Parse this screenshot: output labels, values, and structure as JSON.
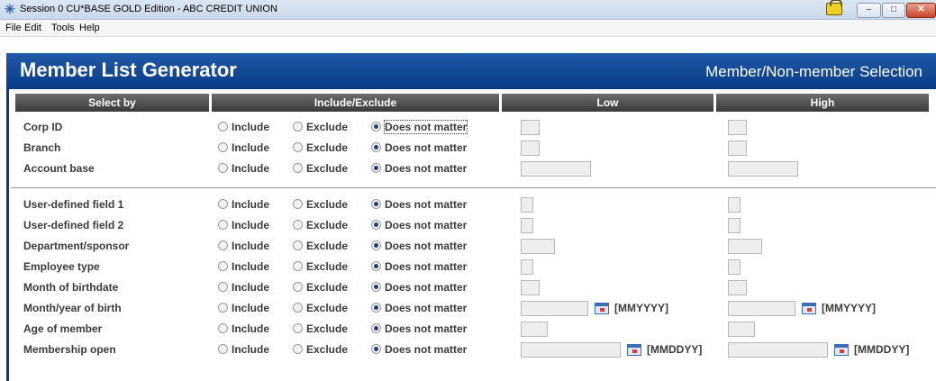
{
  "window": {
    "title": "Session 0 CU*BASE GOLD Edition - ABC CREDIT UNION",
    "min_label": "–",
    "max_label": "□",
    "close_label": "✕"
  },
  "menu": [
    "File",
    "Edit",
    "Tools",
    "Help"
  ],
  "header": {
    "title": "Member List Generator",
    "subtitle": "Member/Non-member Selection"
  },
  "columns": {
    "select_by": "Select by",
    "include_exclude": "Include/Exclude",
    "low": "Low",
    "high": "High"
  },
  "options": {
    "include": "Include",
    "exclude": "Exclude",
    "does_not_matter": "Does not matter"
  },
  "rows": [
    {
      "label": "Corp ID",
      "selected": "does_not_matter",
      "format": ""
    },
    {
      "label": "Branch",
      "selected": "does_not_matter",
      "format": ""
    },
    {
      "label": "Account base",
      "selected": "does_not_matter",
      "format": ""
    },
    {
      "label": "User-defined field 1",
      "selected": "does_not_matter",
      "format": ""
    },
    {
      "label": "User-defined field 2",
      "selected": "does_not_matter",
      "format": ""
    },
    {
      "label": "Department/sponsor",
      "selected": "does_not_matter",
      "format": ""
    },
    {
      "label": "Employee type",
      "selected": "does_not_matter",
      "format": ""
    },
    {
      "label": "Month of birthdate",
      "selected": "does_not_matter",
      "format": ""
    },
    {
      "label": "Month/year of birth",
      "selected": "does_not_matter",
      "format": "[MMYYYY]"
    },
    {
      "label": "Age of member",
      "selected": "does_not_matter",
      "format": ""
    },
    {
      "label": "Membership open",
      "selected": "does_not_matter",
      "format": "[MMDDYY]"
    }
  ],
  "colors": {
    "header_blue": "#0a3b86",
    "column_header": "#4a4a4a",
    "field_bg": "#eeeeee"
  }
}
